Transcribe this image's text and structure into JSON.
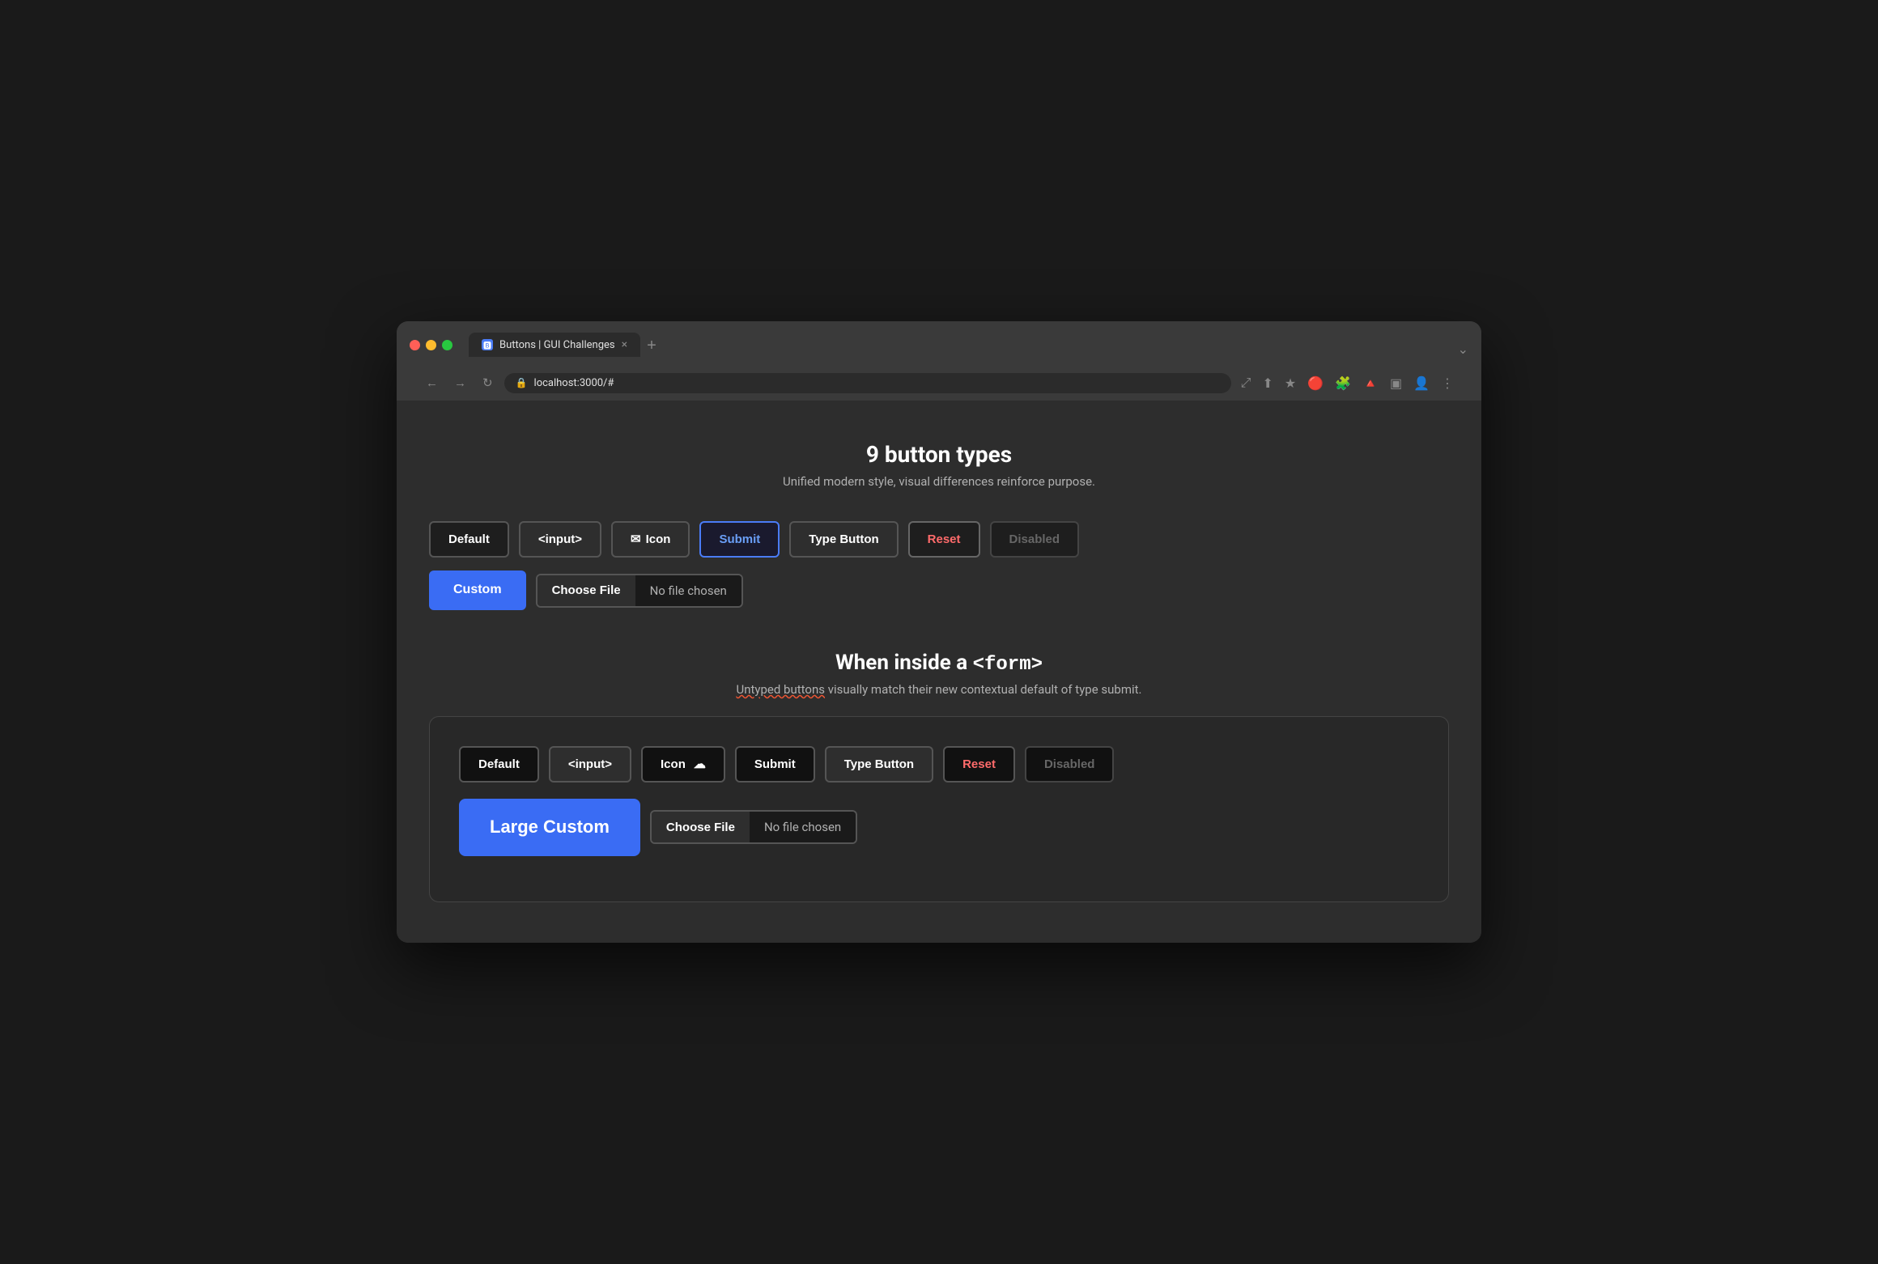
{
  "browser": {
    "url": "localhost:3000/#",
    "tab_title": "Buttons | GUI Challenges",
    "tab_close": "×",
    "tab_new": "+",
    "nav": {
      "back": "←",
      "forward": "→",
      "reload": "↻",
      "menu": "⋮"
    }
  },
  "page": {
    "heading": "9 button types",
    "subheading": "Unified modern style, visual differences reinforce purpose.",
    "section2_heading_prefix": "When inside a ",
    "section2_heading_code": "<form>",
    "section2_subheading": "Untyped buttons visually match their new contextual default of type submit.",
    "section2_underlined": "Untyped buttons"
  },
  "buttons_row1": {
    "default_label": "Default",
    "input_label": "<input>",
    "icon_label": "Icon",
    "submit_label": "Submit",
    "type_button_label": "Type Button",
    "reset_label": "Reset",
    "disabled_label": "Disabled"
  },
  "buttons_row2": {
    "custom_label": "Custom",
    "choose_file_label": "Choose File",
    "no_file_label": "No file chosen"
  },
  "form_buttons_row1": {
    "default_label": "Default",
    "input_label": "<input>",
    "icon_label": "Icon",
    "submit_label": "Submit",
    "type_button_label": "Type Button",
    "reset_label": "Reset",
    "disabled_label": "Disabled"
  },
  "form_buttons_row2": {
    "custom_label": "Large Custom",
    "choose_file_label": "Choose File",
    "no_file_label": "No file chosen"
  }
}
